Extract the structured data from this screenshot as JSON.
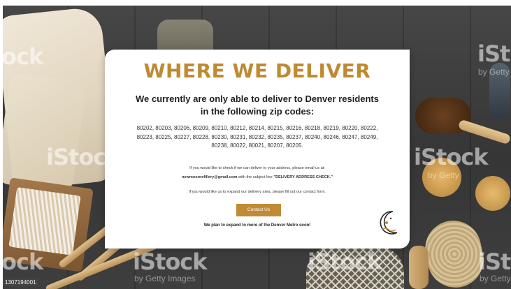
{
  "heading": "WHERE WE DELIVER",
  "subheading_line1": "We currently are only able to deliver to Denver residents",
  "subheading_line2": "in the following zip codes:",
  "zip_line1": "80202, 80203, 80206, 80209, 80210, 80212, 80214, 80215, 80216, 80218, 80219, 80220, 80222,",
  "zip_line2": "80223, 80225, 80227, 80228, 80230, 80231, 80232, 80235, 80237, 80240, 80246, 80247, 80249,",
  "zip_line3": "80238, 80022, 80021, 80207, 80205.",
  "check_line1": "If you would like to check if we can deliver to your address, please email us at:",
  "email": "newmoonrefillery@gmail.com",
  "subject_prefix": " with the subject line ",
  "subject_line": "\"DELIVERY ADDRESS CHECK.\"",
  "expand_text": "If you would like us to expand our delivery area, please fill out our contact form.",
  "contact_button": "Contact Us",
  "plan_text": "We plan to expand to more of the Denver Metro soon!",
  "watermark": {
    "brand": "iStock",
    "brand_fragment_left": "ock",
    "brand_fragment_right": "iSt",
    "sub": "by Getty Images",
    "sub_fragment": "by Getty",
    "stock_id": "1307194001"
  },
  "colors": {
    "accent": "#c08b34",
    "heading": "#bf8a32",
    "card": "#ffffff"
  }
}
